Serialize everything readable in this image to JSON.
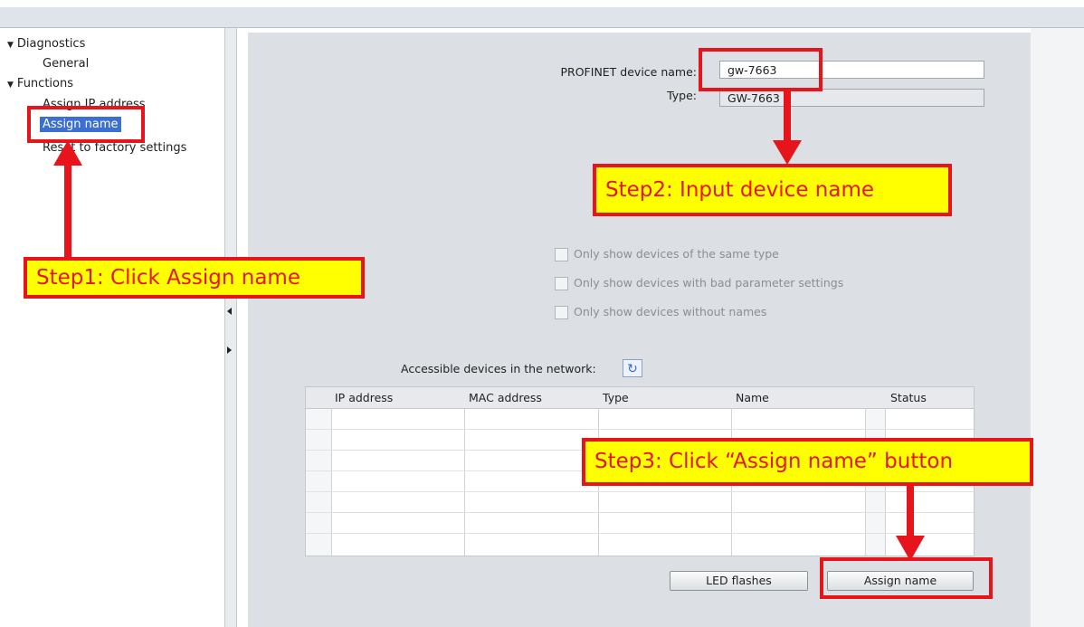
{
  "sidebar": {
    "items": [
      {
        "label": "Diagnostics",
        "type": "folder"
      },
      {
        "label": "General",
        "type": "leaf"
      },
      {
        "label": "Functions",
        "type": "folder"
      },
      {
        "label": "Assign IP address",
        "type": "leaf"
      },
      {
        "label": "Assign name",
        "type": "leaf",
        "selected": true
      },
      {
        "label": "Reset to factory settings",
        "type": "leaf"
      }
    ]
  },
  "form": {
    "device_name_label": "PROFINET device name:",
    "device_name_value": "gw-7663",
    "type_label": "Type:",
    "type_value": "GW-7663"
  },
  "filters": [
    {
      "label": "Only show devices of the same type",
      "checked": false
    },
    {
      "label": "Only show devices with bad parameter settings",
      "checked": false
    },
    {
      "label": "Only show devices without names",
      "checked": false
    }
  ],
  "network": {
    "label": "Accessible devices in the network:",
    "refresh_icon": "refresh-icon",
    "columns": [
      "IP address",
      "MAC address",
      "Type",
      "Name",
      "Status"
    ],
    "rows": []
  },
  "buttons": {
    "led_flashes": "LED flashes",
    "assign_name": "Assign name"
  },
  "annotations": {
    "step1": "Step1: Click Assign name",
    "step2": "Step2: Input device name",
    "step3": "Step3: Click “Assign name” button"
  },
  "colors": {
    "accent_red": "#e8141c",
    "callout_yellow": "#ffff00",
    "selection_blue": "#3b6fd0"
  }
}
